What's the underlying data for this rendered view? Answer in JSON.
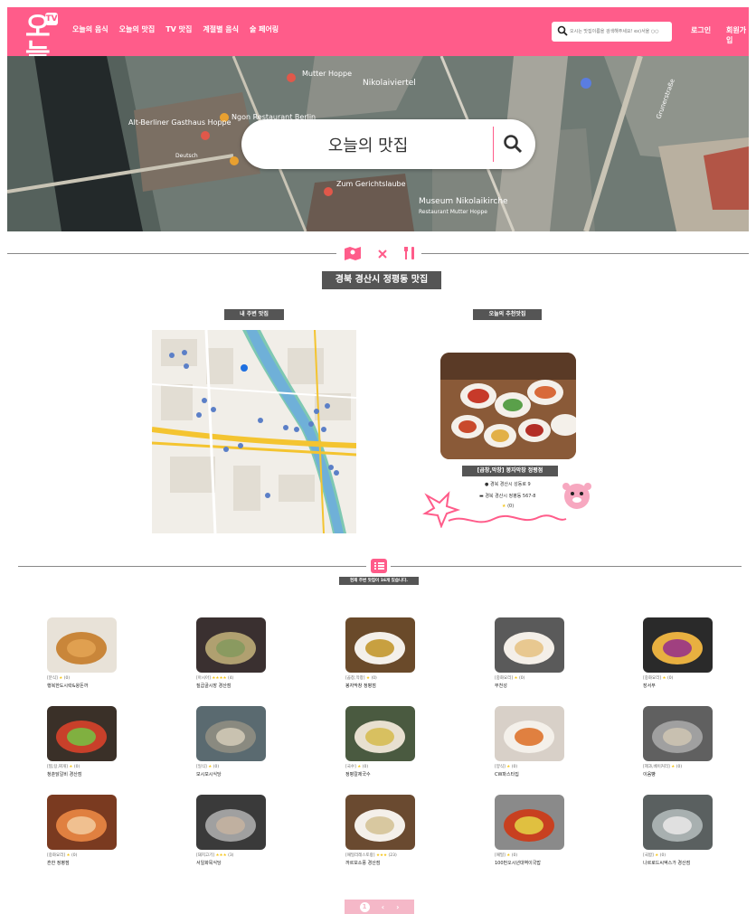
{
  "header": {
    "logo_text": "오늘",
    "logo_tag": "TV",
    "nav": [
      "오늘의 음식",
      "오늘의 맛집",
      "TV 맛집",
      "계절별 음식",
      "술 페어링"
    ],
    "search_placeholder": "오시는 맛집이름을 검색해주세요! ex)서울 ○○",
    "login": "로그인",
    "signup": "회원가입"
  },
  "hero": {
    "search_text": "오늘의 맛집",
    "map_labels": [
      "Mutter Hoppe",
      "Nikolaiviertel",
      "Alt-Berliner Gasthaus Hoppe",
      "Ngon Restaurant Berlin",
      "Zum Gerichtslaube",
      "Museum Nikolaikirche",
      "Restaurant Mutter Hoppe",
      "Deutsch",
      "Grunerstraße"
    ]
  },
  "region": {
    "title": "경북 경산시 정평동 맛집"
  },
  "nearby": {
    "label": "내 주변 맛집"
  },
  "recommend": {
    "label": "오늘의 추천맛집",
    "name": "[곱창,막창] 봉자막창 정평점",
    "addr1": "경북 경산시 성동로 9",
    "addr2": "경북 경산시 정평동 567-8",
    "rating": "★",
    "reviews": "(0)"
  },
  "list": {
    "notice": "현재 주변 맛집이 16개 있습니다.",
    "items": [
      {
        "cat": "[분식]",
        "stars": "★",
        "count": "(0)",
        "name": "행복한도시락&왕돈까"
      },
      {
        "cat": "[아시아]",
        "stars": "★★★★",
        "count": "(4)",
        "name": "질곱골시장 경산점"
      },
      {
        "cat": "[곱창,막창]",
        "stars": "★",
        "count": "(0)",
        "name": "봉자막창 정평점"
      },
      {
        "cat": "[중화요리]",
        "stars": "★",
        "count": "(0)",
        "name": "부천성"
      },
      {
        "cat": "[중화요리]",
        "stars": "★",
        "count": "(0)",
        "name": "장서부"
      },
      {
        "cat": "[찜,탕,찌개]",
        "stars": "★",
        "count": "(0)",
        "name": "청춘닭갈비 경산점"
      },
      {
        "cat": "[일식]",
        "stars": "★",
        "count": "(0)",
        "name": "모시모시식당"
      },
      {
        "cat": "[국수]",
        "stars": "★",
        "count": "(0)",
        "name": "정평칼제국수"
      },
      {
        "cat": "[양식]",
        "stars": "★",
        "count": "(0)",
        "name": "CW파스타집"
      },
      {
        "cat": "[제과,베이커리]",
        "stars": "★",
        "count": "(0)",
        "name": "이음빵"
      },
      {
        "cat": "[중화요리]",
        "stars": "★",
        "count": "(0)",
        "name": "흔한 정평점"
      },
      {
        "cat": "[돼지고기]",
        "stars": "★★★",
        "count": "(3)",
        "name": "서일화목식당"
      },
      {
        "cat": "[패밀리레스토랑]",
        "stars": "★★★",
        "count": "(23)",
        "name": "까르보소풍 경산점"
      },
      {
        "cat": "[패밀]",
        "stars": "★",
        "count": "(0)",
        "name": "100번오시년대역이국밥"
      },
      {
        "cat": "[국밥]",
        "stars": "★",
        "count": "(0)",
        "name": "나르로드씨엑스가 경산점"
      }
    ]
  },
  "pager": {
    "current": "1",
    "prev": "‹",
    "next": "›"
  },
  "colors": {
    "brand": "#ff5c8a",
    "dark_label": "#555555"
  }
}
